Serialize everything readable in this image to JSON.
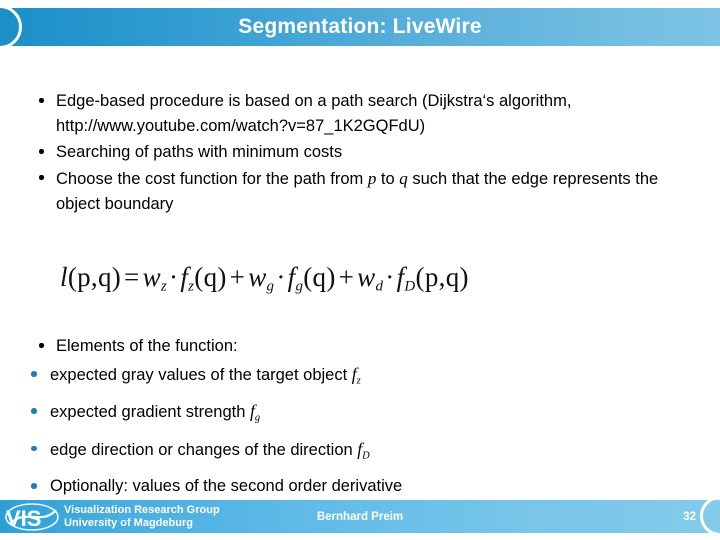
{
  "slide": {
    "title": "Segmentation: LiveWire"
  },
  "content": {
    "bullets_top": [
      "Edge-based procedure is based on a path search (Dijkstra‘s algorithm, http://www.youtube.com/watch?v=87_1K2GQFdU)",
      "Searching of paths with minimum costs"
    ],
    "bullet_cost_function": {
      "part1": "Choose the cost function for the path from ",
      "var_p": "p",
      "part2": " to ",
      "var_q": "q",
      "part3": " such that the edge represents the object boundary"
    },
    "formula": {
      "latex": "l(p,q) = w_z · f_z(q) + w_g · f_g(q) + w_d · f_D(p,q)",
      "lhs_fn": "l",
      "lhs_args": "(p,q)",
      "equals": "=",
      "terms": [
        {
          "weight": "w",
          "weight_sub": "z",
          "dot": "·",
          "fn": "f",
          "fn_sub": "z",
          "args": "(q)"
        },
        {
          "weight": "w",
          "weight_sub": "g",
          "dot": "·",
          "fn": "f",
          "fn_sub": "g",
          "args": "(q)"
        },
        {
          "weight": "w",
          "weight_sub": "d",
          "dot": "·",
          "fn": "f",
          "fn_sub": "D",
          "args": "(p,q)"
        }
      ],
      "plus": "+"
    },
    "elements_header": "Elements of the function:",
    "elements": [
      {
        "text": "expected gray values of the target object ",
        "fn": "f",
        "fn_sub": "z"
      },
      {
        "text": "expected gradient strength ",
        "fn": "f",
        "fn_sub": "g"
      },
      {
        "text": "edge direction or changes of the direction ",
        "fn": "f",
        "fn_sub": "D"
      },
      {
        "text": "Optionally: values of the second order derivative",
        "fn": "",
        "fn_sub": ""
      }
    ]
  },
  "footer": {
    "logo_text": "VIS",
    "org_line1": "Visualization Research Group",
    "org_line2": "University of Magdeburg",
    "author": "Bernhard Preim",
    "page_number": "32"
  },
  "colors": {
    "title_bar_left": "#1a8fc8",
    "title_bar_right": "#7cc3e4",
    "footer_left": "#2ba0d4",
    "footer_right": "#82cbeb",
    "sub_bullet": "#1f7fb5",
    "text": "#000000",
    "title_text": "#ffffff"
  }
}
